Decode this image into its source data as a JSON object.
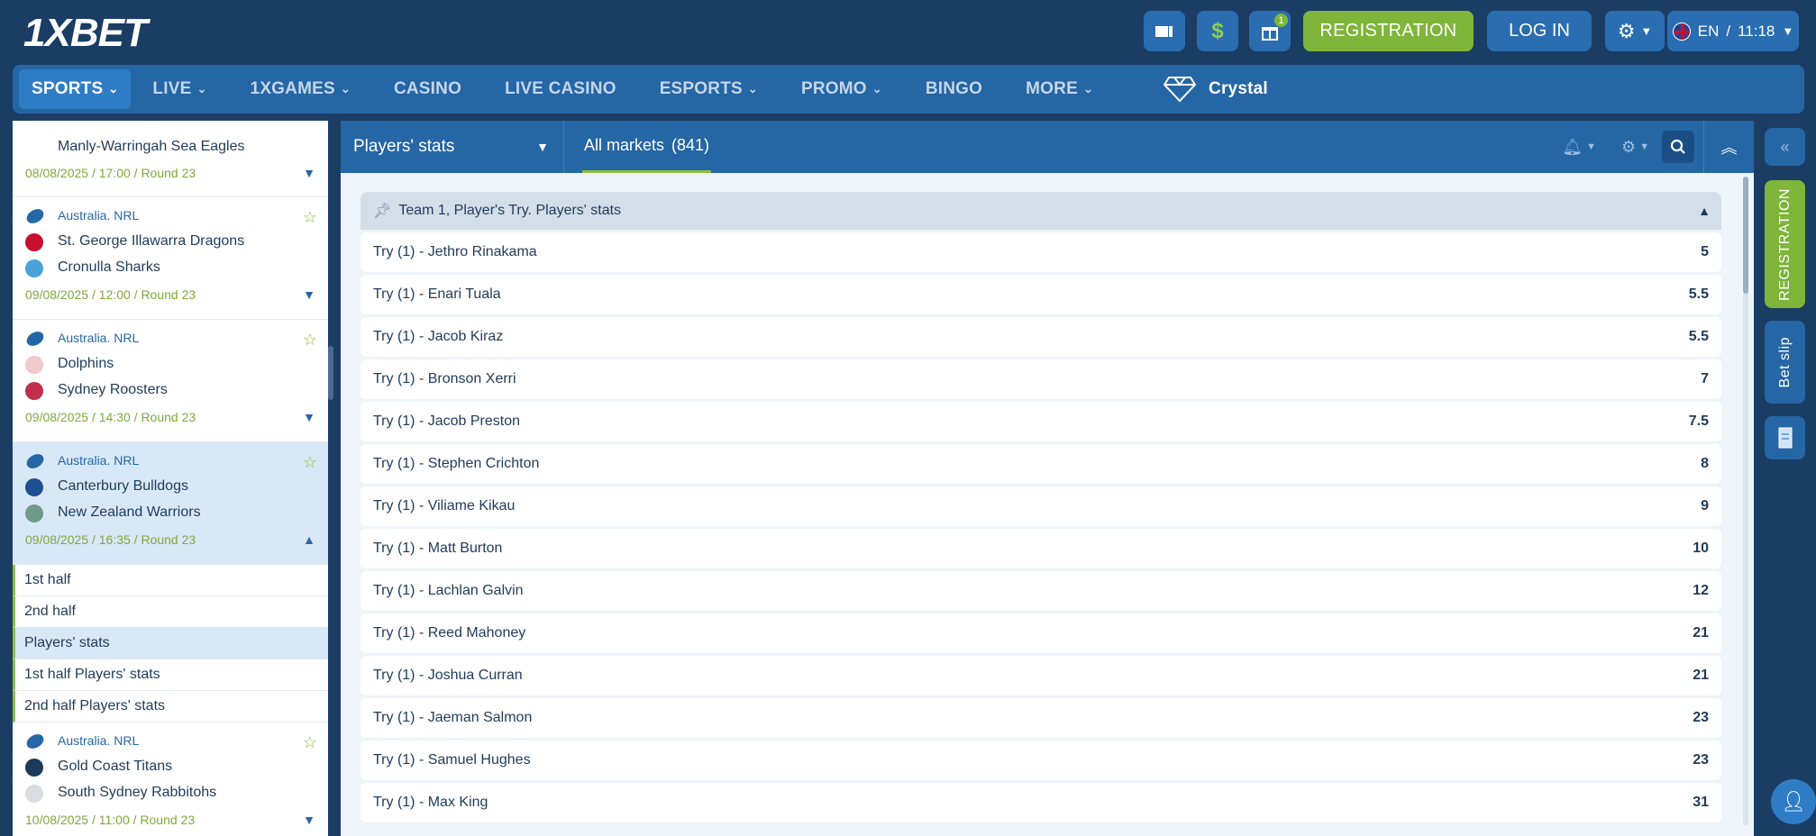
{
  "header": {
    "logo": "1XBET",
    "gift_count": "1",
    "registration": "REGISTRATION",
    "login": "LOG IN",
    "language": "EN",
    "time": "11:18"
  },
  "nav": {
    "items": [
      {
        "label": "SPORTS"
      },
      {
        "label": "LIVE"
      },
      {
        "label": "1XGAMES"
      },
      {
        "label": "CASINO"
      },
      {
        "label": "LIVE CASINO"
      },
      {
        "label": "ESPORTS"
      },
      {
        "label": "PROMO"
      },
      {
        "label": "BINGO"
      },
      {
        "label": "MORE"
      }
    ],
    "crystal": "Crystal"
  },
  "sidebar": {
    "partial": {
      "team": "Manly-Warringah Sea Eagles",
      "date": "08/08/2025 / 17:00 / Round 23"
    },
    "matches": [
      {
        "league": "Australia. NRL",
        "team1": "St. George Illawarra Dragons",
        "team2": "Cronulla Sharks",
        "date": "09/08/2025 / 12:00 / Round 23"
      },
      {
        "league": "Australia. NRL",
        "team1": "Dolphins",
        "team2": "Sydney Roosters",
        "date": "09/08/2025 / 14:30 / Round 23"
      },
      {
        "league": "Australia. NRL",
        "team1": "Canterbury Bulldogs",
        "team2": "New Zealand Warriors",
        "date": "09/08/2025 / 16:35 / Round 23"
      },
      {
        "league": "Australia. NRL",
        "team1": "Gold Coast Titans",
        "team2": "South Sydney Rabbitohs",
        "date": "10/08/2025 / 11:00 / Round 23"
      }
    ],
    "submenu": [
      "1st half",
      "2nd half",
      "Players' stats",
      "1st half Players' stats",
      "2nd half Players' stats"
    ]
  },
  "center": {
    "dropdown": "Players' stats",
    "all_markets": "All markets",
    "markets_count": "(841)",
    "group_title": "Team 1, Player's Try. Players' stats",
    "rows": [
      {
        "label": "Try (1) - Jethro Rinakama",
        "odd": "5"
      },
      {
        "label": "Try (1) - Enari Tuala",
        "odd": "5.5"
      },
      {
        "label": "Try (1) - Jacob Kiraz",
        "odd": "5.5"
      },
      {
        "label": "Try (1) - Bronson Xerri",
        "odd": "7"
      },
      {
        "label": "Try (1) - Jacob Preston",
        "odd": "7.5"
      },
      {
        "label": "Try (1) - Stephen Crichton",
        "odd": "8"
      },
      {
        "label": "Try (1) - Viliame Kikau",
        "odd": "9"
      },
      {
        "label": "Try (1) - Matt Burton",
        "odd": "10"
      },
      {
        "label": "Try (1) - Lachlan Galvin",
        "odd": "12"
      },
      {
        "label": "Try (1) - Reed Mahoney",
        "odd": "21"
      },
      {
        "label": "Try (1) - Joshua Curran",
        "odd": "21"
      },
      {
        "label": "Try (1) - Jaeman Salmon",
        "odd": "23"
      },
      {
        "label": "Try (1) - Samuel Hughes",
        "odd": "23"
      },
      {
        "label": "Try (1) - Max King",
        "odd": "31"
      }
    ]
  },
  "rail": {
    "registration": "REGISTRATION",
    "bet_slip": "Bet slip"
  },
  "colors": {
    "brand_dark": "#1b3d64",
    "brand_blue": "#2566a5",
    "accent_green": "#7fb53a"
  }
}
